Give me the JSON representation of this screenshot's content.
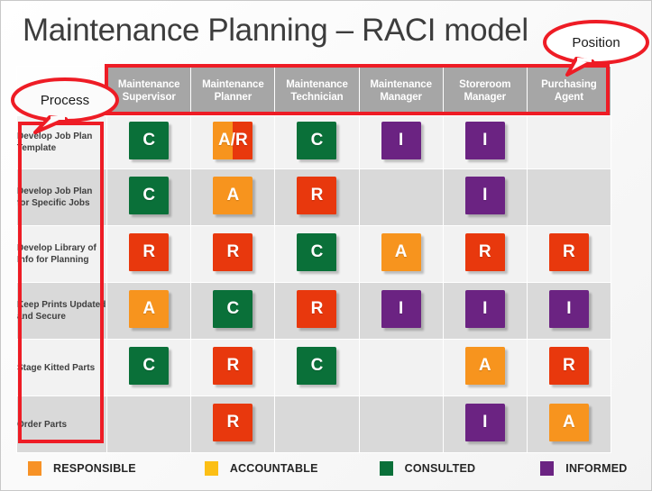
{
  "slide": {
    "title": "Maintenance Planning – RACI model"
  },
  "annotations": {
    "position": {
      "label": "Position",
      "target": "column-headers-row",
      "color": "#ee1c25"
    },
    "process": {
      "label": "Process",
      "target": "row-labels-column",
      "color": "#ee1c25"
    }
  },
  "matrix": {
    "columns": [
      {
        "id": "maintenance-supervisor",
        "line1": "Maintenance",
        "line2": "Supervisor"
      },
      {
        "id": "maintenance-planner",
        "line1": "Maintenance",
        "line2": "Planner"
      },
      {
        "id": "maintenance-technician",
        "line1": "Maintenance",
        "line2": "Technician"
      },
      {
        "id": "maintenance-manager",
        "line1": "Maintenance",
        "line2": "Manager"
      },
      {
        "id": "storeroom-manager",
        "line1": "Storeroom",
        "line2": "Manager"
      },
      {
        "id": "purchasing-agent",
        "line1": "Purchasing",
        "line2": "Agent"
      }
    ],
    "rows": [
      {
        "id": "develop-job-plan-template",
        "label": "Develop Job Plan Template",
        "band": "light",
        "cells": [
          "C",
          "A/R",
          "C",
          "I",
          "I",
          ""
        ]
      },
      {
        "id": "develop-job-plan-for-specific-jobs",
        "label": "Develop Job Plan for Specific Jobs",
        "band": "dark",
        "cells": [
          "C",
          "A",
          "R",
          "",
          "I",
          ""
        ]
      },
      {
        "id": "develop-library-of-info-for-planning",
        "label": "Develop Library of Info for Planning",
        "band": "light",
        "cells": [
          "R",
          "R",
          "C",
          "A",
          "R",
          "R"
        ]
      },
      {
        "id": "keep-prints-updated-and-secure",
        "label": "Keep Prints Updated and Secure",
        "band": "dark",
        "cells": [
          "A",
          "C",
          "R",
          "I",
          "I",
          "I"
        ]
      },
      {
        "id": "stage-kitted-parts",
        "label": "Stage  Kitted Parts",
        "band": "light",
        "cells": [
          "C",
          "R",
          "C",
          "",
          "A",
          "R"
        ]
      },
      {
        "id": "order-parts",
        "label": "Order Parts",
        "band": "dark",
        "cells": [
          "",
          "R",
          "",
          "",
          "I",
          "A"
        ]
      }
    ]
  },
  "legend": [
    {
      "id": "responsible",
      "label": "RESPONSIBLE",
      "color": "#f79226"
    },
    {
      "id": "accountable",
      "label": "ACCOUNTABLE",
      "color": "#fcbf15"
    },
    {
      "id": "consulted",
      "label": "CONSULTED",
      "color": "#0a7039"
    },
    {
      "id": "informed",
      "label": "INFORMED",
      "color": "#6b2382"
    }
  ],
  "tile_colors": {
    "R": "#e8380d",
    "A": "#f7941e",
    "C": "#0a7039",
    "I": "#6b2382"
  },
  "header_color": "#a6a6a6",
  "band_light": "#f2f2f2",
  "band_dark": "#d9d9d9"
}
